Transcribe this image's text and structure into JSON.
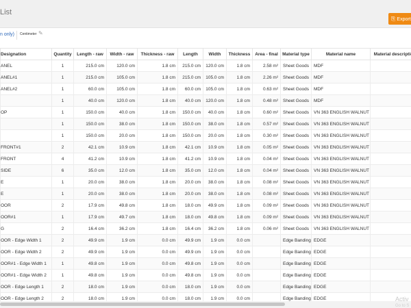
{
  "header": {
    "title": "List",
    "export_label": "Export",
    "export_icon": "export-icon"
  },
  "toolbar": {
    "unit_note": "n only)",
    "unit_value": "Centimeter",
    "edit_icon": "pencil-icon"
  },
  "table": {
    "columns": [
      "Designation",
      "Quantity",
      "Length - raw",
      "Width - raw",
      "Thickness - raw",
      "Length",
      "Width",
      "Thickness",
      "Area - final",
      "Material type",
      "Material name",
      "Material description"
    ],
    "rows": [
      [
        "ANEL",
        "1",
        "215.0 cm",
        "120.0 cm",
        "1.8 cm",
        "215.0 cm",
        "120.0 cm",
        "1.8 cm",
        "2.58 m²",
        "Sheet Goods",
        "MDF",
        ""
      ],
      [
        "ANEL#1",
        "1",
        "215.0 cm",
        "105.0 cm",
        "1.8 cm",
        "215.0 cm",
        "105.0 cm",
        "1.8 cm",
        "2.26 m²",
        "Sheet Goods",
        "MDF",
        ""
      ],
      [
        "ANEL#2",
        "1",
        "60.0 cm",
        "105.0 cm",
        "1.8 cm",
        "60.0 cm",
        "105.0 cm",
        "1.8 cm",
        "0.63 m²",
        "Sheet Goods",
        "MDF",
        ""
      ],
      [
        "",
        "1",
        "40.0 cm",
        "120.0 cm",
        "1.8 cm",
        "40.0 cm",
        "120.0 cm",
        "1.8 cm",
        "0.48 m²",
        "Sheet Goods",
        "MDF",
        ""
      ],
      [
        "OP",
        "1",
        "150.0 cm",
        "40.0 cm",
        "1.8 cm",
        "150.0 cm",
        "40.0 cm",
        "1.8 cm",
        "0.60 m²",
        "Sheet Goods",
        "VN 363 ENGLISH WALNUT",
        ""
      ],
      [
        "",
        "1",
        "150.0 cm",
        "38.0 cm",
        "1.8 cm",
        "150.0 cm",
        "38.0 cm",
        "1.8 cm",
        "0.57 m²",
        "Sheet Goods",
        "VN 363 ENGLISH WALNUT",
        ""
      ],
      [
        "",
        "1",
        "150.0 cm",
        "20.0 cm",
        "1.8 cm",
        "150.0 cm",
        "20.0 cm",
        "1.8 cm",
        "0.30 m²",
        "Sheet Goods",
        "VN 363 ENGLISH WALNUT",
        ""
      ],
      [
        "FRONT#1",
        "2",
        "42.1 cm",
        "10.9 cm",
        "1.8 cm",
        "42.1 cm",
        "10.9 cm",
        "1.8 cm",
        "0.05 m²",
        "Sheet Goods",
        "VN 363 ENGLISH WALNUT",
        ""
      ],
      [
        "FRONT",
        "4",
        "41.2 cm",
        "10.9 cm",
        "1.8 cm",
        "41.2 cm",
        "10.9 cm",
        "1.8 cm",
        "0.04 m²",
        "Sheet Goods",
        "VN 363 ENGLISH WALNUT",
        ""
      ],
      [
        "SIDE",
        "6",
        "35.0 cm",
        "12.0 cm",
        "1.8 cm",
        "35.0 cm",
        "12.0 cm",
        "1.8 cm",
        "0.04 m²",
        "Sheet Goods",
        "VN 363 ENGLISH WALNUT",
        ""
      ],
      [
        "E",
        "1",
        "20.0 cm",
        "38.0 cm",
        "1.8 cm",
        "20.0 cm",
        "38.0 cm",
        "1.8 cm",
        "0.08 m²",
        "Sheet Goods",
        "VN 363 ENGLISH WALNUT",
        ""
      ],
      [
        "E",
        "1",
        "20.0 cm",
        "38.0 cm",
        "1.8 cm",
        "20.0 cm",
        "38.0 cm",
        "1.8 cm",
        "0.08 m²",
        "Sheet Goods",
        "VN 363 ENGLISH WALNUT",
        ""
      ],
      [
        "OOR",
        "2",
        "17.9 cm",
        "49.8 cm",
        "1.8 cm",
        "18.0 cm",
        "49.9 cm",
        "1.8 cm",
        "0.09 m²",
        "Sheet Goods",
        "VN 363 ENGLISH WALNUT",
        ""
      ],
      [
        "OOR#1",
        "1",
        "17.9 cm",
        "49.7 cm",
        "1.8 cm",
        "18.0 cm",
        "49.8 cm",
        "1.8 cm",
        "0.09 m²",
        "Sheet Goods",
        "VN 363 ENGLISH WALNUT",
        ""
      ],
      [
        "G",
        "2",
        "16.4 cm",
        "36.2 cm",
        "1.8 cm",
        "16.4 cm",
        "36.2 cm",
        "1.8 cm",
        "0.06 m²",
        "Sheet Goods",
        "VN 363 ENGLISH WALNUT",
        ""
      ],
      [
        "OOR - Edge Width 1",
        "2",
        "49.9 cm",
        "1.9 cm",
        "0.0 cm",
        "49.9 cm",
        "1.9 cm",
        "0.0 cm",
        "",
        "Edge Banding",
        "EDGE",
        ""
      ],
      [
        "OOR - Edge Width 2",
        "2",
        "49.9 cm",
        "1.9 cm",
        "0.0 cm",
        "49.9 cm",
        "1.9 cm",
        "0.0 cm",
        "",
        "Edge Banding",
        "EDGE",
        ""
      ],
      [
        "OOR#1 - Edge Width 1",
        "1",
        "49.8 cm",
        "1.9 cm",
        "0.0 cm",
        "49.8 cm",
        "1.9 cm",
        "0.0 cm",
        "",
        "Edge Banding",
        "EDGE",
        ""
      ],
      [
        "OOR#1 - Edge Width 2",
        "1",
        "49.8 cm",
        "1.9 cm",
        "0.0 cm",
        "49.8 cm",
        "1.9 cm",
        "0.0 cm",
        "",
        "Edge Banding",
        "EDGE",
        ""
      ],
      [
        "OOR - Edge Length 1",
        "2",
        "18.0 cm",
        "1.9 cm",
        "0.0 cm",
        "18.0 cm",
        "1.9 cm",
        "0.0 cm",
        "",
        "Edge Banding",
        "EDGE",
        ""
      ],
      [
        "OOR - Edge Length 2",
        "2",
        "18.0 cm",
        "1.9 cm",
        "0.0 cm",
        "18.0 cm",
        "1.9 cm",
        "0.0 cm",
        "",
        "Edge Banding",
        "EDGE",
        ""
      ]
    ]
  },
  "watermark": {
    "line1": "Activ",
    "line2": "Go to S"
  },
  "colors": {
    "accent": "#ef8a14",
    "link": "#2a66b8"
  }
}
